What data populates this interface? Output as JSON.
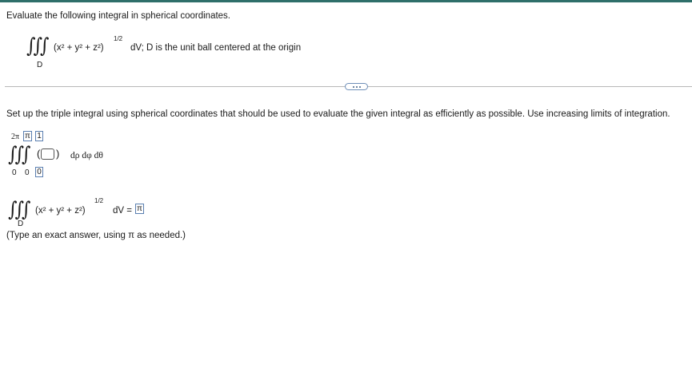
{
  "theme": {
    "accent_bar": "#2f6f6a",
    "answer_box_border": "#5a7fb0"
  },
  "header": {
    "prompt": "Evaluate the following integral in spherical coordinates."
  },
  "given": {
    "integrand": "(x² + y² + z²)",
    "exponent": "1/2",
    "tail": "dV; D is the unit ball centered at the origin",
    "region": "D"
  },
  "toolbar": {
    "more_icon": "ellipsis-icon"
  },
  "instructions": "Set up the triple integral using spherical coordinates that should be used to evaluate the given integral as efficiently as possible. Use increasing limits of integration.",
  "setup": {
    "upper_limits": [
      "2π",
      "π",
      "1"
    ],
    "lower_limits": [
      "0",
      "0",
      "0"
    ],
    "integrand_box": "",
    "differentials": "dρ dφ dθ"
  },
  "result": {
    "integrand": "(x² + y² + z²)",
    "exponent": "1/2",
    "equals": "dV =",
    "answer": "π",
    "region": "D",
    "hint": "(Type an exact answer, using π as needed.)"
  }
}
